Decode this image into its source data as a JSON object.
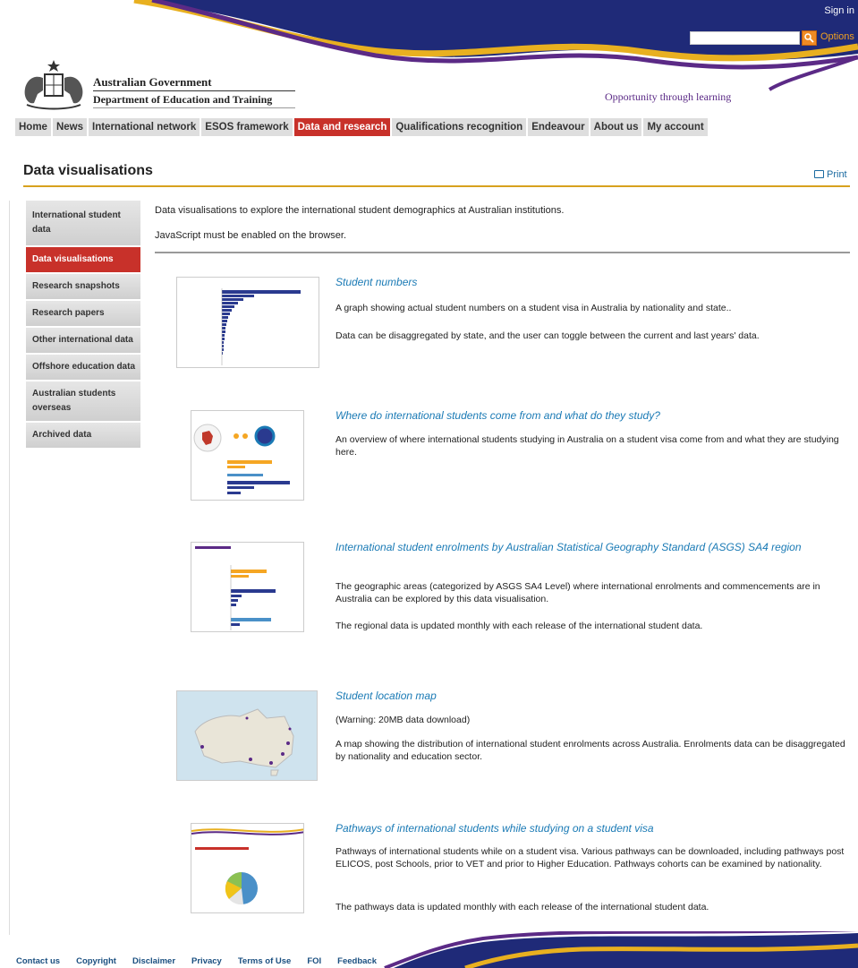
{
  "header": {
    "sign_in": "Sign in",
    "options": "Options",
    "gov_name": "Australian Government",
    "dept_name": "Department of Education and Training",
    "tagline": "Opportunity through learning",
    "colors": {
      "navy": "#1f2a78",
      "purple": "#5b2a86",
      "gold": "#e8b020"
    }
  },
  "nav": {
    "tabs": [
      "Home",
      "News",
      "International network",
      "ESOS framework",
      "Data and research",
      "Qualifications recognition",
      "Endeavour",
      "About us",
      "My account"
    ],
    "active": "Data and research",
    "active_color": "#c8312a"
  },
  "page": {
    "title": "Data visualisations",
    "print": "Print"
  },
  "sidebar": {
    "items": [
      "International student data",
      "Data visualisations",
      "Research snapshots",
      "Research papers",
      "Other international data",
      "Offshore education data",
      "Australian students overseas",
      "Archived data"
    ],
    "active": "Data visualisations"
  },
  "intro": {
    "line1": "Data visualisations to explore the international student demographics at Australian institutions.",
    "line2": "JavaScript must be enabled on the browser."
  },
  "items": [
    {
      "title": "Student numbers",
      "paras": [
        "A  graph showing actual student numbers on a student visa in Australia by nationality and state..",
        "Data can be disaggregated by state, and the user can toggle between the current and last years' data."
      ]
    },
    {
      "title": "Where do international students come from and what do they study?",
      "paras": [
        "An overview of where international students studying in Australia on a student visa come from and what they are studying here."
      ]
    },
    {
      "title": "International student enrolments by Australian Statistical Geography Standard (ASGS) SA4 region",
      "paras": [
        "The geographic areas (categorized by ASGS SA4 Level) where international enrolments and commencements are in Australia can be explored by this data visualisation.",
        "The regional data is updated monthly with each release of the international student data."
      ]
    },
    {
      "title": "Student location map",
      "paras": [
        "(Warning: 20MB data download)",
        "A map showing the distribution of international student enrolments across Australia. Enrolments data can be disaggregated by nationality and education sector."
      ]
    },
    {
      "title": "Pathways of international students while studying on a student visa",
      "paras": [
        "Pathways of international students while on a student visa.  Various pathways can be downloaded, including pathways post ELICOS, post Schools, prior to VET and prior to Higher Education.  Pathways cohorts can be examined by nationality.",
        "The pathways data is updated monthly with each release of the international student data."
      ]
    }
  ],
  "footer": {
    "links": [
      "Contact us",
      "Copyright",
      "Disclaimer",
      "Privacy",
      "Terms of Use",
      "FOI",
      "Feedback"
    ]
  }
}
